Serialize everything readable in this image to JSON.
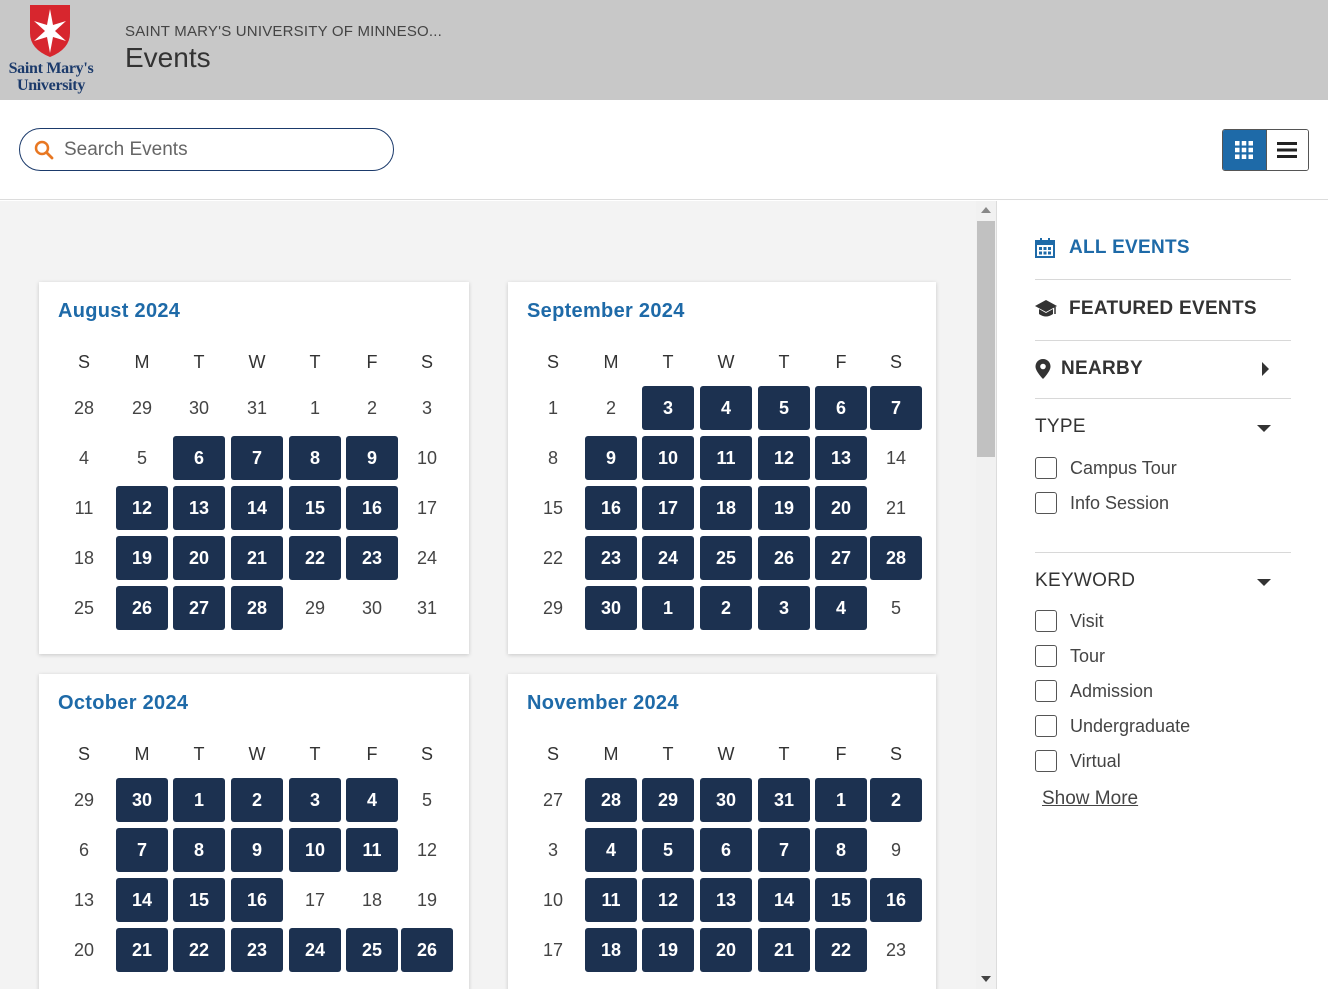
{
  "header": {
    "logo_text": [
      "Saint Mary's",
      "University"
    ],
    "org_name": "SAINT MARY'S UNIVERSITY OF MINNESO...",
    "title": "Events"
  },
  "search": {
    "placeholder": "Search Events",
    "value": ""
  },
  "view_toggle": {
    "active": "grid-view",
    "options": [
      "grid-view",
      "list-view"
    ]
  },
  "colors": {
    "accent": "#1e6aa8",
    "event_day": "#1c3150",
    "header_bg": "#c8c8c8"
  },
  "weekday_headers": [
    "S",
    "M",
    "T",
    "W",
    "T",
    "F",
    "S"
  ],
  "calendars": [
    {
      "title": "August 2024",
      "weeks": [
        [
          [
            28,
            0
          ],
          [
            29,
            0
          ],
          [
            30,
            0
          ],
          [
            31,
            0
          ],
          [
            1,
            0
          ],
          [
            2,
            0
          ],
          [
            3,
            0
          ]
        ],
        [
          [
            4,
            0
          ],
          [
            5,
            0
          ],
          [
            6,
            1
          ],
          [
            7,
            1
          ],
          [
            8,
            1
          ],
          [
            9,
            1
          ],
          [
            10,
            0
          ]
        ],
        [
          [
            11,
            0
          ],
          [
            12,
            1
          ],
          [
            13,
            1
          ],
          [
            14,
            1
          ],
          [
            15,
            1
          ],
          [
            16,
            1
          ],
          [
            17,
            0
          ]
        ],
        [
          [
            18,
            0
          ],
          [
            19,
            1
          ],
          [
            20,
            1
          ],
          [
            21,
            1
          ],
          [
            22,
            1
          ],
          [
            23,
            1
          ],
          [
            24,
            0
          ]
        ],
        [
          [
            25,
            0
          ],
          [
            26,
            1
          ],
          [
            27,
            1
          ],
          [
            28,
            1
          ],
          [
            29,
            0
          ],
          [
            30,
            0
          ],
          [
            31,
            0
          ]
        ]
      ]
    },
    {
      "title": "September 2024",
      "weeks": [
        [
          [
            1,
            0
          ],
          [
            2,
            0
          ],
          [
            3,
            1
          ],
          [
            4,
            1
          ],
          [
            5,
            1
          ],
          [
            6,
            1
          ],
          [
            7,
            1
          ]
        ],
        [
          [
            8,
            0
          ],
          [
            9,
            1
          ],
          [
            10,
            1
          ],
          [
            11,
            1
          ],
          [
            12,
            1
          ],
          [
            13,
            1
          ],
          [
            14,
            0
          ]
        ],
        [
          [
            15,
            0
          ],
          [
            16,
            1
          ],
          [
            17,
            1
          ],
          [
            18,
            1
          ],
          [
            19,
            1
          ],
          [
            20,
            1
          ],
          [
            21,
            0
          ]
        ],
        [
          [
            22,
            0
          ],
          [
            23,
            1
          ],
          [
            24,
            1
          ],
          [
            25,
            1
          ],
          [
            26,
            1
          ],
          [
            27,
            1
          ],
          [
            28,
            1
          ]
        ],
        [
          [
            29,
            0
          ],
          [
            30,
            1
          ],
          [
            1,
            1
          ],
          [
            2,
            1
          ],
          [
            3,
            1
          ],
          [
            4,
            1
          ],
          [
            5,
            0
          ]
        ]
      ]
    },
    {
      "title": "October 2024",
      "weeks": [
        [
          [
            29,
            0
          ],
          [
            30,
            1
          ],
          [
            1,
            1
          ],
          [
            2,
            1
          ],
          [
            3,
            1
          ],
          [
            4,
            1
          ],
          [
            5,
            0
          ]
        ],
        [
          [
            6,
            0
          ],
          [
            7,
            1
          ],
          [
            8,
            1
          ],
          [
            9,
            1
          ],
          [
            10,
            1
          ],
          [
            11,
            1
          ],
          [
            12,
            0
          ]
        ],
        [
          [
            13,
            0
          ],
          [
            14,
            1
          ],
          [
            15,
            1
          ],
          [
            16,
            1
          ],
          [
            17,
            0
          ],
          [
            18,
            0
          ],
          [
            19,
            0
          ]
        ],
        [
          [
            20,
            0
          ],
          [
            21,
            1
          ],
          [
            22,
            1
          ],
          [
            23,
            1
          ],
          [
            24,
            1
          ],
          [
            25,
            1
          ],
          [
            26,
            1
          ]
        ]
      ]
    },
    {
      "title": "November 2024",
      "weeks": [
        [
          [
            27,
            0
          ],
          [
            28,
            1
          ],
          [
            29,
            1
          ],
          [
            30,
            1
          ],
          [
            31,
            1
          ],
          [
            1,
            1
          ],
          [
            2,
            1
          ]
        ],
        [
          [
            3,
            0
          ],
          [
            4,
            1
          ],
          [
            5,
            1
          ],
          [
            6,
            1
          ],
          [
            7,
            1
          ],
          [
            8,
            1
          ],
          [
            9,
            0
          ]
        ],
        [
          [
            10,
            0
          ],
          [
            11,
            1
          ],
          [
            12,
            1
          ],
          [
            13,
            1
          ],
          [
            14,
            1
          ],
          [
            15,
            1
          ],
          [
            16,
            1
          ]
        ],
        [
          [
            17,
            0
          ],
          [
            18,
            1
          ],
          [
            19,
            1
          ],
          [
            20,
            1
          ],
          [
            21,
            1
          ],
          [
            22,
            1
          ],
          [
            23,
            0
          ]
        ]
      ]
    }
  ],
  "sidebar": {
    "all_events": "ALL EVENTS",
    "featured_events": "FEATURED EVENTS",
    "nearby": "NEARBY",
    "type_heading": "TYPE",
    "type_options": [
      "Campus Tour",
      "Info Session"
    ],
    "keyword_heading": "KEYWORD",
    "keyword_options": [
      "Visit",
      "Tour",
      "Admission",
      "Undergraduate",
      "Virtual"
    ],
    "show_more": "Show More"
  }
}
